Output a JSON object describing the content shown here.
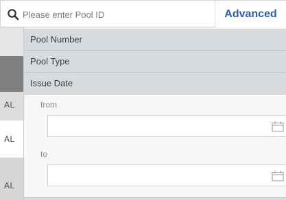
{
  "search": {
    "placeholder": "Please enter Pool ID",
    "value": "",
    "advanced_label": "Advanced"
  },
  "background_rows": [
    {
      "text": ""
    },
    {
      "text": ""
    },
    {
      "text": "AL"
    },
    {
      "text": "AL"
    },
    {
      "text": "AL"
    }
  ],
  "panel": {
    "sections": [
      {
        "label": "Pool Number"
      },
      {
        "label": "Pool Type"
      },
      {
        "label": "Issue Date"
      }
    ],
    "issue_date": {
      "from_label": "from",
      "from_value": "",
      "to_label": "to",
      "to_value": ""
    }
  },
  "colors": {
    "accent": "#2d5ea8",
    "section_header_bg": "#d7dbde",
    "panel_bg": "#f7f7f7"
  },
  "icons": {
    "search": "magnifier-icon",
    "calendar": "calendar-icon"
  }
}
